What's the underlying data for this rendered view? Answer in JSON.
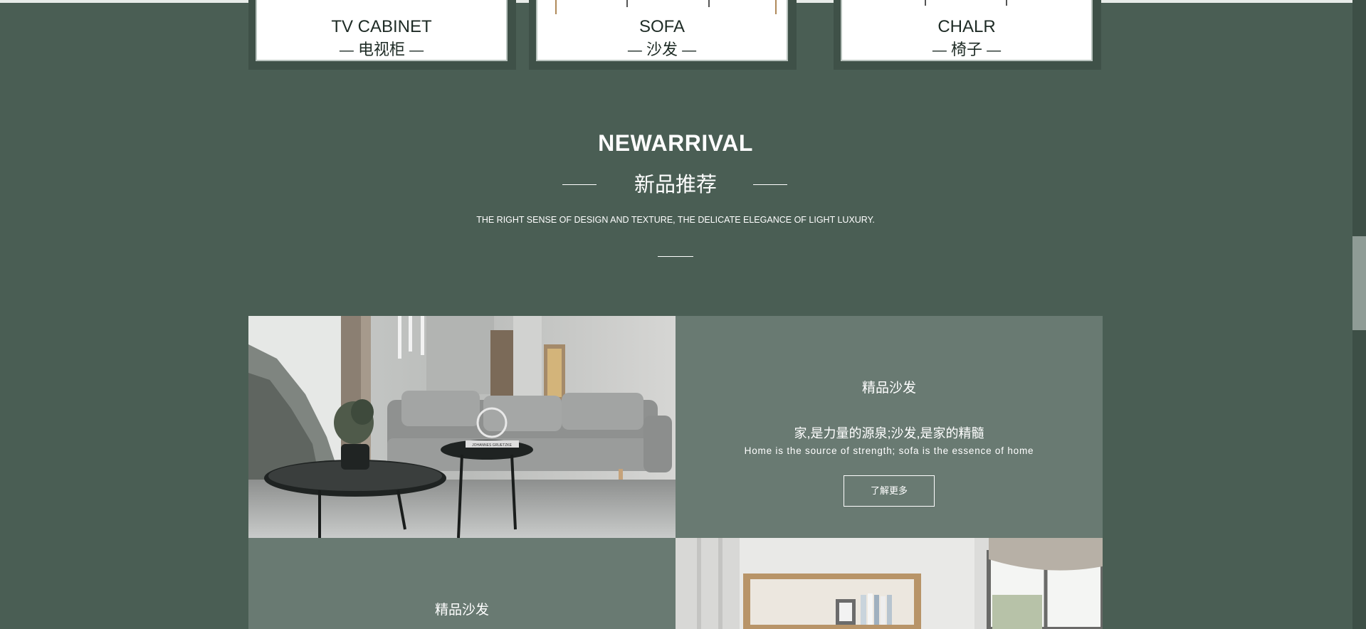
{
  "categories": [
    {
      "en": "TV CABINET",
      "zh": "电视柜",
      "dash": "—"
    },
    {
      "en": "SOFA",
      "zh": "沙发",
      "dash": "—"
    },
    {
      "en": "CHALR",
      "zh": "椅子",
      "dash": "—"
    }
  ],
  "section": {
    "title": "NEWARRIVAL",
    "subtitle": "新品推荐",
    "tagline": "THE RIGHT SENSE OF DESIGN AND TEXTURE, THE DELICATE ELEGANCE OF LIGHT LUXURY."
  },
  "products": [
    {
      "title": "精品沙发",
      "slogan_zh": "家,是力量的源泉;沙发,是家的精髓",
      "slogan_en": "Home is the source of strength; sofa is the essence of home",
      "button": "了解更多"
    },
    {
      "title": "精品沙发"
    }
  ],
  "photos": {
    "living_room": "living-room-sofa-photo",
    "shelf_room": "bookshelf-room-photo",
    "book_label": "JOHANNES GRUETZKE"
  }
}
